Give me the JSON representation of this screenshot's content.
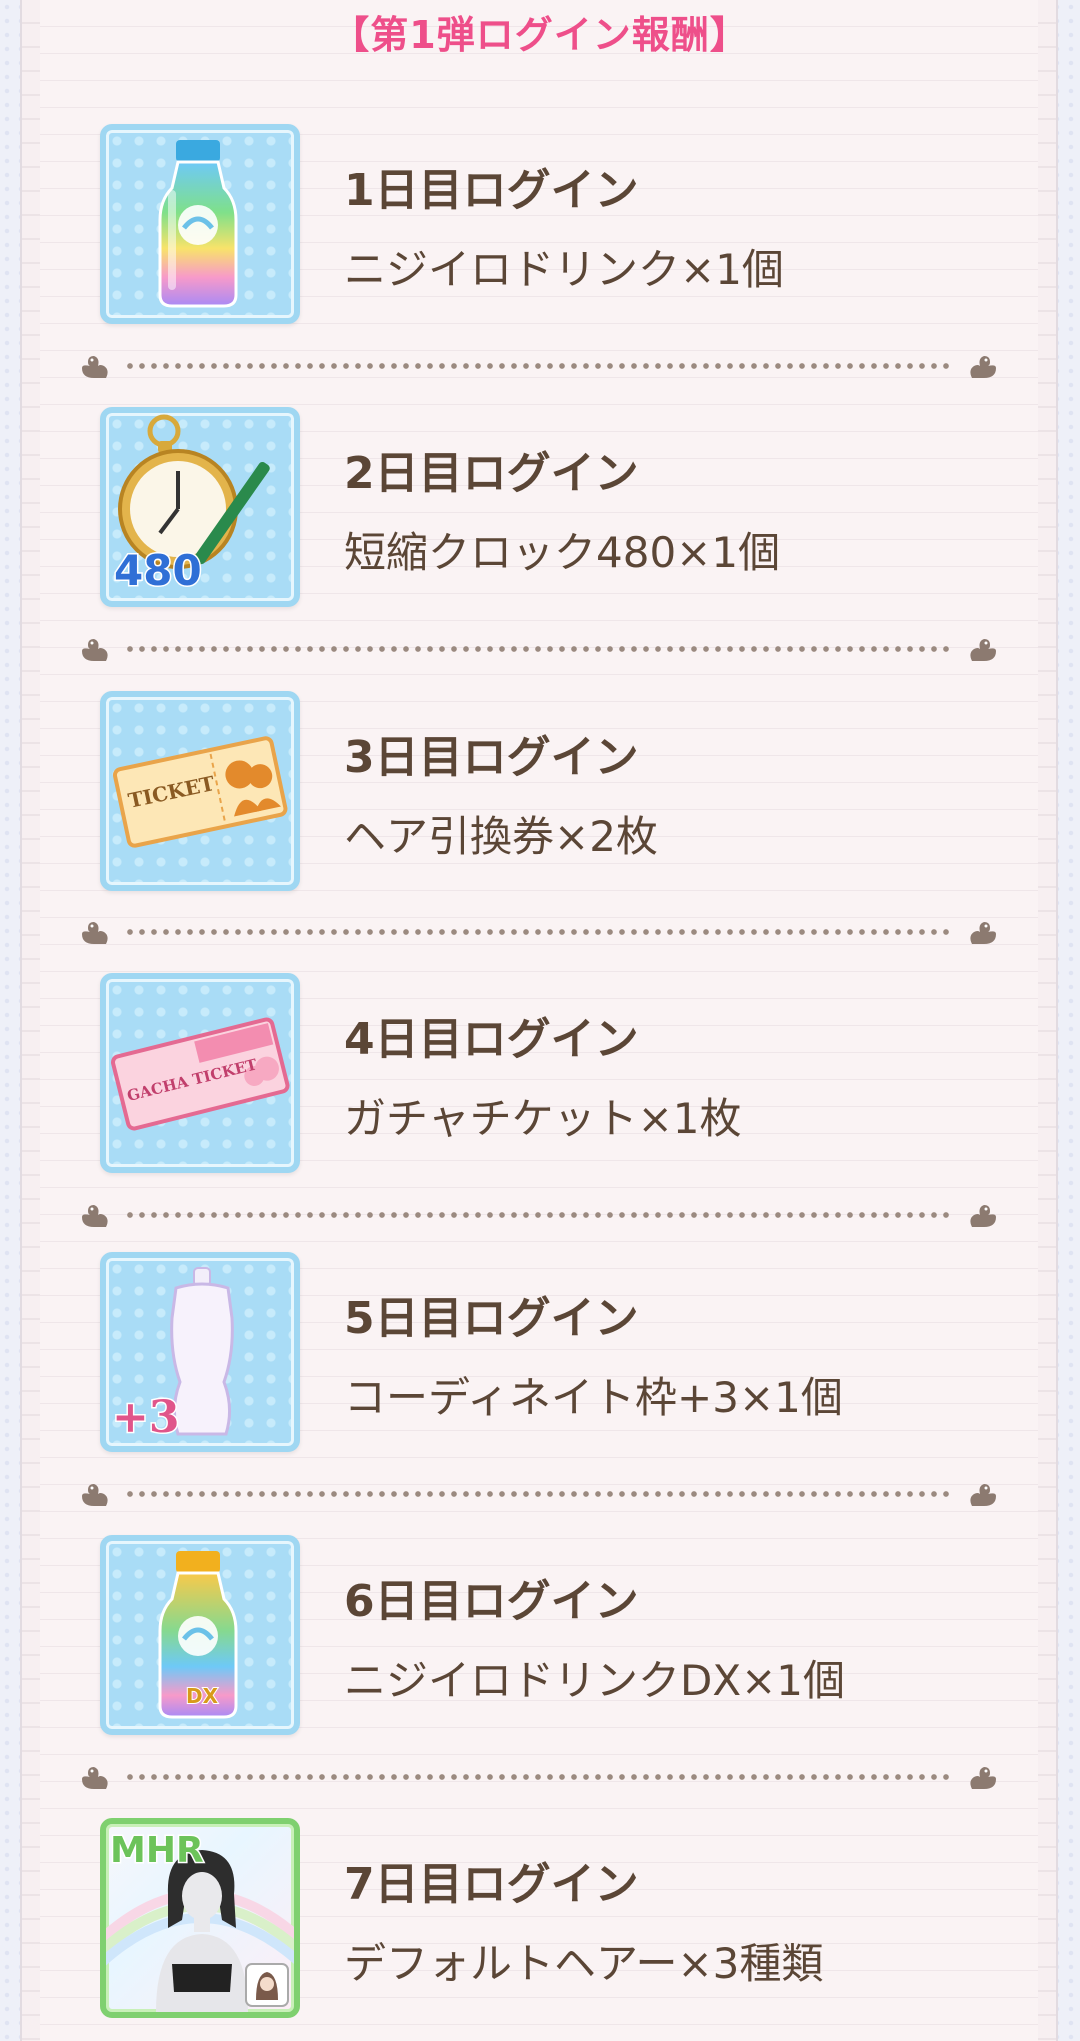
{
  "section_title": "【第1弾ログイン報酬】",
  "rewards": [
    {
      "day": "1日目ログイン",
      "item": "ニジイロドリンク×1個",
      "icon": "rainbow-drink-bottle-icon"
    },
    {
      "day": "2日目ログイン",
      "item": "短縮クロック480×1個",
      "icon": "pocket-watch-clock-icon",
      "badge": "480"
    },
    {
      "day": "3日目ログイン",
      "item": "ヘア引換券×2枚",
      "icon": "hair-ticket-icon",
      "badge": "TICKET"
    },
    {
      "day": "4日目ログイン",
      "item": "ガチャチケット×1枚",
      "icon": "gacha-ticket-icon",
      "badge": "GACHA TICKET"
    },
    {
      "day": "5日目ログイン",
      "item": "コーディネイト枠+3×1個",
      "icon": "mannequin-icon",
      "badge": "+3"
    },
    {
      "day": "6日目ログイン",
      "item": "ニジイロドリンクDX×1個",
      "icon": "rainbow-drink-dx-bottle-icon",
      "badge": "DX"
    },
    {
      "day": "7日目ログイン",
      "item": "デフォルトヘアー×3種類",
      "icon": "default-hair-avatar-icon",
      "badge": "MHR"
    }
  ],
  "colors": {
    "title_pink": "#ee4f8a",
    "text_brown": "#5b4636",
    "icon_blue": "#a9dcf6",
    "rarity_green": "#7fd06f"
  }
}
